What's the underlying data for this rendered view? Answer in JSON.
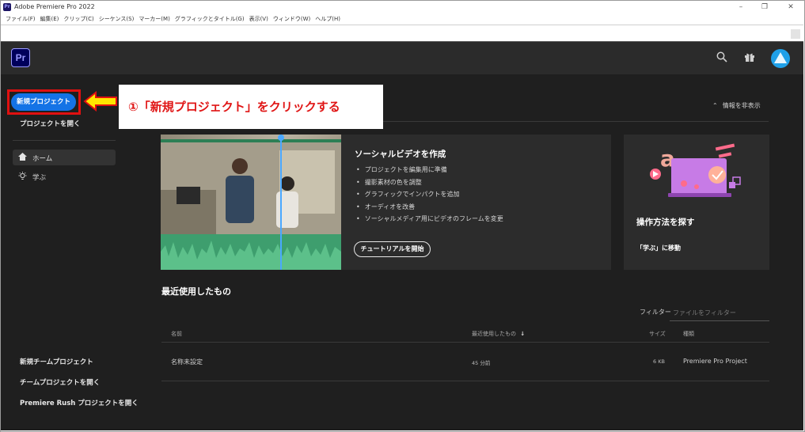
{
  "window": {
    "title": "Adobe Premiere Pro 2022",
    "controls": [
      "–",
      "❐",
      "✕"
    ]
  },
  "menu": [
    "ファイル(F)",
    "編集(E)",
    "クリップ(C)",
    "シーケンス(S)",
    "マーカー(M)",
    "グラフィックとタイトル(G)",
    "表示(V)",
    "ウィンドウ(W)",
    "ヘルプ(H)"
  ],
  "app": {
    "logo": "Pr",
    "accent": "#1473e6"
  },
  "sidebar": {
    "new_project": "新規プロジェクト",
    "open_project": "プロジェクトを開く",
    "nav": [
      {
        "label": "ホーム",
        "icon": "home-icon"
      },
      {
        "label": "学ぶ",
        "icon": "lightbulb-icon"
      }
    ],
    "bottom": [
      "新規チームプロジェクト",
      "チームプロジェクトを開く",
      "Premiere Rush プロジェクトを開く"
    ]
  },
  "annotation": {
    "text": "①「新規プロジェクト」をクリックする",
    "color": "#e01010"
  },
  "main": {
    "hide_info": "情報を非表示",
    "feature": {
      "title": "ソーシャルビデオを作成",
      "bullets": [
        "プロジェクトを編集用に準備",
        "撮影素材の色を調整",
        "グラフィックでインパクトを追加",
        "オーディオを改善",
        "ソーシャルメディア用にビデオのフレームを変更"
      ],
      "button": "チュートリアルを開始"
    },
    "side_card": {
      "title": "操作方法を探す",
      "link": "「学ぶ」に移動"
    },
    "recent": {
      "title": "最近使用したもの",
      "filter_label": "フィルター",
      "filter_placeholder": "ファイルをフィルター",
      "columns": [
        "名前",
        "最近使用したもの",
        "サイズ",
        "種類"
      ],
      "sort_arrow": "↓",
      "rows": [
        {
          "name": "名称未設定",
          "recent": "45 分前",
          "size": "6 KB",
          "type": "Premiere Pro Project"
        }
      ]
    }
  }
}
